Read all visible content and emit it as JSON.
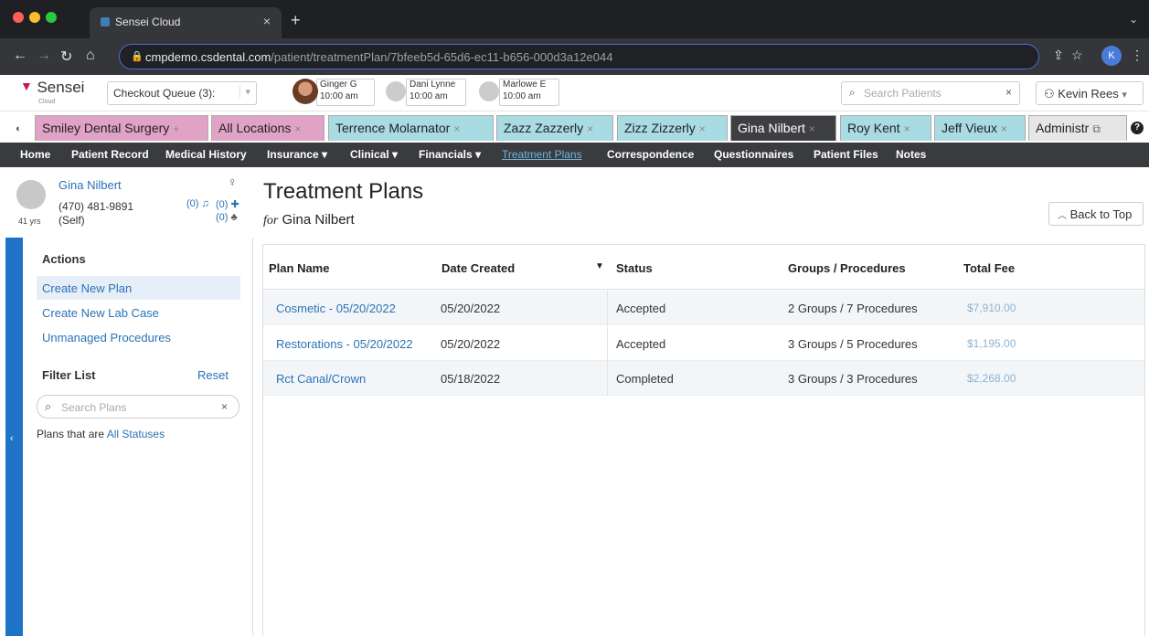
{
  "browser": {
    "tab_title": "Sensei Cloud",
    "url_host": "cmpdemo.csdental.com",
    "url_path": "/patient/treatmentPlan/7bfeeb5d-65d6-ec11-b656-000d3a12e044",
    "profile_initial": "K"
  },
  "header": {
    "logo_name": "Sensei",
    "logo_sub": "Cloud",
    "queue_label": "Checkout Queue (3):",
    "appointments": [
      {
        "name": "Ginger G",
        "time": "10:00 am"
      },
      {
        "name": "Dani Lynne",
        "time": "10:00 am"
      },
      {
        "name": "Marlowe E",
        "time": "10:00 am"
      }
    ],
    "search_placeholder": "Search Patients",
    "user_name": "Kevin Rees"
  },
  "context_tabs": [
    {
      "label": "Smiley Dental Surgery",
      "close": "+",
      "color": "pink"
    },
    {
      "label": "All Locations",
      "close": "×",
      "color": "pink"
    },
    {
      "label": "Terrence Molarnator",
      "close": "×",
      "color": "teal"
    },
    {
      "label": "Zazz Zazzerly",
      "close": "×",
      "color": "teal"
    },
    {
      "label": "Zizz Zizzerly",
      "close": "×",
      "color": "teal"
    },
    {
      "label": "Gina Nilbert",
      "close": "×",
      "color": "dark"
    },
    {
      "label": "Roy Kent",
      "close": "×",
      "color": "teal"
    },
    {
      "label": "Jeff Vieux",
      "close": "×",
      "color": "teal"
    },
    {
      "label": "Administr",
      "close": "",
      "color": "gray"
    }
  ],
  "nav": [
    {
      "label": "Home"
    },
    {
      "label": "Patient Record"
    },
    {
      "label": "Medical History"
    },
    {
      "label": "Insurance ▾"
    },
    {
      "label": "Clinical ▾"
    },
    {
      "label": "Financials ▾"
    },
    {
      "label": "Treatment Plans"
    },
    {
      "label": "Correspondence"
    },
    {
      "label": "Questionnaires"
    },
    {
      "label": "Patient Files"
    },
    {
      "label": "Notes"
    }
  ],
  "patient": {
    "name": "Gina Nilbert",
    "phone": "(470) 481-9891",
    "relation": "(Self)",
    "age": "41 yrs",
    "count1": "(0)",
    "count2": "(0)",
    "count3": "(0)"
  },
  "page": {
    "title": "Treatment Plans",
    "sub_for": "for",
    "sub_name": "Gina Nilbert",
    "back_to_top": "Back to Top"
  },
  "sidebar": {
    "actions_heading": "Actions",
    "actions": [
      "Create New Plan",
      "Create New Lab Case",
      "Unmanaged Procedures"
    ],
    "filter_heading": "Filter List",
    "reset_label": "Reset",
    "search_placeholder": "Search Plans",
    "plans_are_label": "Plans that are",
    "plans_are_value": "All Statuses"
  },
  "table": {
    "columns": [
      "Plan Name",
      "Date Created",
      "Status",
      "Groups / Procedures",
      "Total Fee"
    ],
    "rows": [
      {
        "plan": "Cosmetic - 05/20/2022",
        "date": "05/20/2022",
        "status": "Accepted",
        "groups": "2 Groups / 7 Procedures",
        "fee": "$7,910.00"
      },
      {
        "plan": "Restorations - 05/20/2022",
        "date": "05/20/2022",
        "status": "Accepted",
        "groups": "3 Groups / 5 Procedures",
        "fee": "$1,195.00"
      },
      {
        "plan": "Rct Canal/Crown",
        "date": "05/18/2022",
        "status": "Completed",
        "groups": "3 Groups / 3 Procedures",
        "fee": "$2,268.00"
      }
    ]
  }
}
